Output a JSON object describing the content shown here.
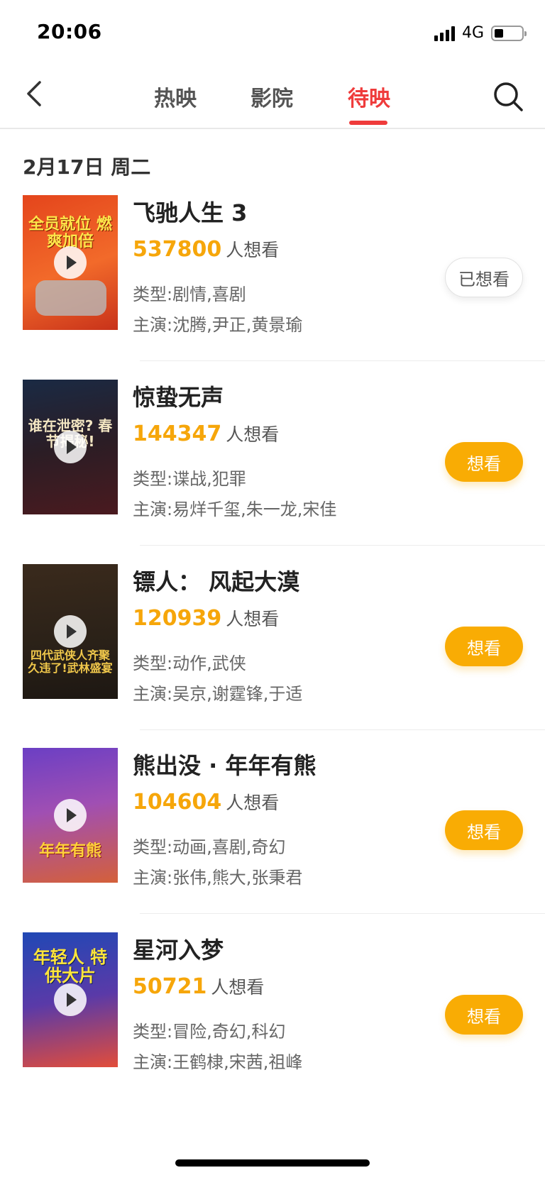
{
  "status_bar": {
    "time": "20:06",
    "network": "4G",
    "battery_level": 0.3
  },
  "nav": {
    "back_icon": "chevron-left-icon",
    "search_icon": "search-icon",
    "tabs": [
      {
        "label": "热映",
        "active": false
      },
      {
        "label": "影院",
        "active": false
      },
      {
        "label": "待映",
        "active": true
      }
    ],
    "active_color": "#ef3b3b"
  },
  "date_header": "2月17日 周二",
  "movies": [
    {
      "title": "飞驰人生 3",
      "want_count": "537800",
      "want_suffix": "人想看",
      "genre": "类型:剧情,喜剧",
      "cast": "主演:沈腾,尹正,黄景瑜",
      "action": "已想看",
      "poster_text": "全员就位 燃爽加倍",
      "poster_colors": [
        "#e4451c",
        "#f7893a"
      ]
    },
    {
      "title": "惊蛰无声",
      "want_count": "144347",
      "want_suffix": "人想看",
      "genre": "类型:谍战,犯罪",
      "cast": "主演:易烊千玺,朱一龙,宋佳",
      "action": "想看",
      "poster_text": "谁在泄密? 春节揭秘!",
      "poster_colors": [
        "#15233a",
        "#4a1a1f"
      ]
    },
    {
      "title": "镖人： 风起大漠",
      "want_count": "120939",
      "want_suffix": "人想看",
      "genre": "类型:动作,武侠",
      "cast": "主演:吴京,谢霆锋,于适",
      "action": "想看",
      "poster_text": "四代武侠人齐聚 久违了!武林盛宴",
      "poster_colors": [
        "#2a2118",
        "#6b4e2c"
      ]
    },
    {
      "title": "熊出没 · 年年有熊",
      "want_count": "104604",
      "want_suffix": "人想看",
      "genre": "类型:动画,喜剧,奇幻",
      "cast": "主演:张伟,熊大,张秉君",
      "action": "想看",
      "poster_text": "年年有熊",
      "poster_colors": [
        "#7a3db8",
        "#e45a8c"
      ]
    },
    {
      "title": "星河入梦",
      "want_count": "50721",
      "want_suffix": "人想看",
      "genre": "类型:冒险,奇幻,科幻",
      "cast": "主演:王鹤棣,宋茜,祖峰",
      "action": "想看",
      "poster_text": "年轻人 特供大片",
      "poster_colors": [
        "#1f3c9c",
        "#e24d3a"
      ]
    }
  ],
  "colors": {
    "want_count": "#f6a60a",
    "want_button": "#f9ac04"
  }
}
